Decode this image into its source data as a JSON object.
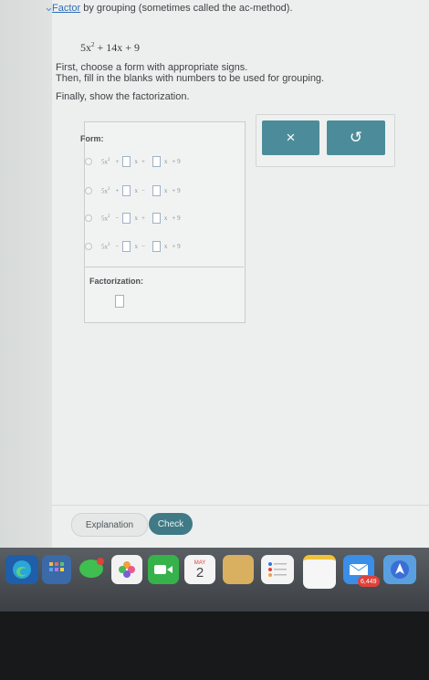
{
  "header": {
    "title_link": "Factor",
    "title_rest": " by grouping (sometimes called the ac-method).",
    "expression": {
      "a": "5x",
      "exp": "2",
      "rest": " + 14x + 9"
    }
  },
  "instructions": [
    "First, choose a form with appropriate signs.",
    "Then, fill in the blanks with numbers to be used for grouping.",
    "Finally, show the factorization."
  ],
  "form": {
    "label": "Form:",
    "options": [
      {
        "lead": "5x",
        "exp": "2",
        "s1": "+",
        "x1": "x",
        "s2": "+",
        "x2": "x",
        "tail": "+ 9"
      },
      {
        "lead": "5x",
        "exp": "2",
        "s1": "+",
        "x1": "x",
        "s2": "−",
        "x2": "x",
        "tail": "+ 9"
      },
      {
        "lead": "5x",
        "exp": "2",
        "s1": "−",
        "x1": "x",
        "s2": "+",
        "x2": "x",
        "tail": "+ 9"
      },
      {
        "lead": "5x",
        "exp": "2",
        "s1": "−",
        "x1": "x",
        "s2": "−",
        "x2": "x",
        "tail": "+ 9"
      }
    ]
  },
  "factorization": {
    "label": "Factorization:"
  },
  "tools": {
    "clear": "×",
    "undo": "↺"
  },
  "footer": {
    "explanation": "Explanation",
    "check": "Check"
  },
  "dock": {
    "calendar_month": "MAY",
    "calendar_day": "2",
    "mail_badge": "6,449"
  }
}
